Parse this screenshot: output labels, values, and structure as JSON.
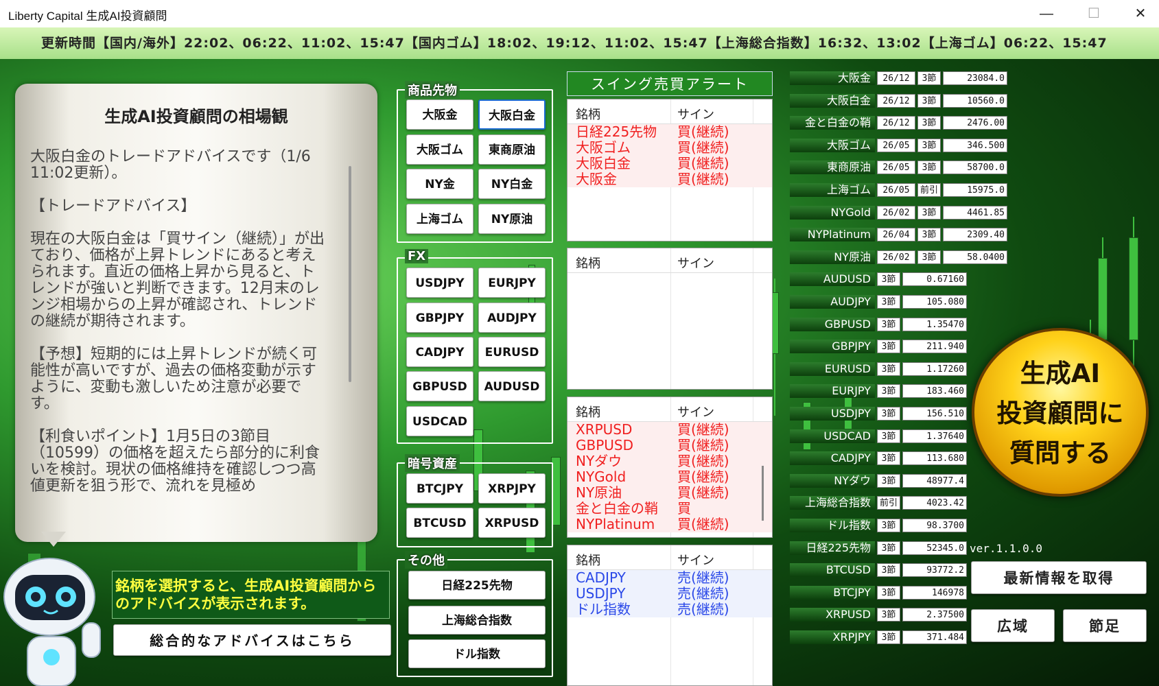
{
  "window": {
    "title": "Liberty Capital 生成AI投資顧問",
    "min": "—",
    "max": "☐",
    "close": "✕"
  },
  "ticker": "更新時間【国内/海外】22:02、06:22、11:02、15:47【国内ゴム】18:02、19:12、11:02、15:47【上海総合指数】16:32、13:02【上海ゴム】06:22、15:47",
  "advice": {
    "title": "生成AI投資顧問の相場観",
    "body": "大阪白金のトレードアドバイスです（1/6 11:02更新）。\n\n【トレードアドバイス】\n\n現在の大阪白金は「買サイン（継続）」が出ており、価格が上昇トレンドにあると考えられます。直近の価格上昇から見ると、トレンドが強いと判断できます。12月末のレンジ相場からの上昇が確認され、トレンドの継続が期待されます。\n\n【予想】短期的には上昇トレンドが続く可能性が高いですが、過去の価格変動が示すように、変動も激しいため注意が必要です。\n\n【利食いポイント】1月5日の3節目（10599）の価格を超えたら部分的に利食いを検討。現状の価格維持を確認しつつ高値更新を狙う形で、流れを見極め"
  },
  "instruction": "銘柄を選択すると、生成AI投資顧問からのアドバイスが表示されます。",
  "overall_button": "総合的なアドバイスはこちら",
  "groups": {
    "commodities": {
      "title": "商品先物",
      "items": [
        "大阪金",
        "大阪白金",
        "大阪ゴム",
        "東商原油",
        "NY金",
        "NY白金",
        "上海ゴム",
        "NY原油"
      ]
    },
    "fx": {
      "title": "FX",
      "items": [
        "USDJPY",
        "EURJPY",
        "GBPJPY",
        "AUDJPY",
        "CADJPY",
        "EURUSD",
        "GBPUSD",
        "AUDUSD",
        "USDCAD"
      ]
    },
    "crypto": {
      "title": "暗号資産",
      "items": [
        "BTCJPY",
        "XRPJPY",
        "BTCUSD",
        "XRPUSD"
      ]
    },
    "other": {
      "title": "その他",
      "items": [
        "日経225先物",
        "上海総合指数",
        "ドル指数"
      ]
    }
  },
  "alerts": {
    "title": "スイング売買アラート",
    "col_name": "銘柄",
    "col_sign": "サイン",
    "list1": [
      [
        "日経225先物",
        "買(継続)"
      ],
      [
        "大阪ゴム",
        "買(継続)"
      ],
      [
        "大阪白金",
        "買(継続)"
      ],
      [
        "大阪金",
        "買(継続)"
      ]
    ],
    "list3": [
      [
        "XRPUSD",
        "買(継続)"
      ],
      [
        "GBPUSD",
        "買(継続)"
      ],
      [
        "NYダウ",
        "買(継続)"
      ],
      [
        "NYGold",
        "買(継続)"
      ],
      [
        "NY原油",
        "買(継続)"
      ],
      [
        "金と白金の鞘",
        "買"
      ],
      [
        "NYPlatinum",
        "買(継続)"
      ]
    ],
    "list4": [
      [
        "CADJPY",
        "売(継続)"
      ],
      [
        "USDJPY",
        "売(継続)"
      ],
      [
        "ドル指数",
        "売(継続)"
      ]
    ]
  },
  "prices": [
    [
      "大阪金",
      "26/12",
      "3節",
      "23084.0"
    ],
    [
      "大阪白金",
      "26/12",
      "3節",
      "10560.0"
    ],
    [
      "金と白金の鞘",
      "26/12",
      "3節",
      "2476.00"
    ],
    [
      "大阪ゴム",
      "26/05",
      "3節",
      "346.500"
    ],
    [
      "東商原油",
      "26/05",
      "3節",
      "58700.0"
    ],
    [
      "上海ゴム",
      "26/05",
      "前引",
      "15975.0"
    ],
    [
      "NYGold",
      "26/02",
      "3節",
      "4461.85"
    ],
    [
      "NYPlatinum",
      "26/04",
      "3節",
      "2309.40"
    ],
    [
      "NY原油",
      "26/02",
      "3節",
      "58.0400"
    ],
    [
      "AUDUSD",
      "3節",
      "0.67160"
    ],
    [
      "AUDJPY",
      "3節",
      "105.080"
    ],
    [
      "GBPUSD",
      "3節",
      "1.35470"
    ],
    [
      "GBPJPY",
      "3節",
      "211.940"
    ],
    [
      "EURUSD",
      "3節",
      "1.17260"
    ],
    [
      "EURJPY",
      "3節",
      "183.460"
    ],
    [
      "USDJPY",
      "3節",
      "156.510"
    ],
    [
      "USDCAD",
      "3節",
      "1.37640"
    ],
    [
      "CADJPY",
      "3節",
      "113.680"
    ],
    [
      "NYダウ",
      "3節",
      "48977.4"
    ],
    [
      "上海総合指数",
      "前引",
      "4023.42"
    ],
    [
      "ドル指数",
      "3節",
      "98.3700"
    ],
    [
      "日経225先物",
      "3節",
      "52345.0"
    ],
    [
      "BTCUSD",
      "3節",
      "93772.2"
    ],
    [
      "BTCJPY",
      "3節",
      "146978"
    ],
    [
      "XRPUSD",
      "3節",
      "2.37500"
    ],
    [
      "XRPJPY",
      "3節",
      "371.484"
    ]
  ],
  "gold_button": {
    "l1": "生成AI",
    "l2": "投資顧問に",
    "l3": "質問する"
  },
  "version": "ver.1.1.0.0",
  "refresh": "最新情報を取得",
  "wide": "広域",
  "setsuashi": "節足",
  "colors": {
    "buy": "#f02020",
    "sell": "#2a48e8",
    "accent": "#228822"
  }
}
